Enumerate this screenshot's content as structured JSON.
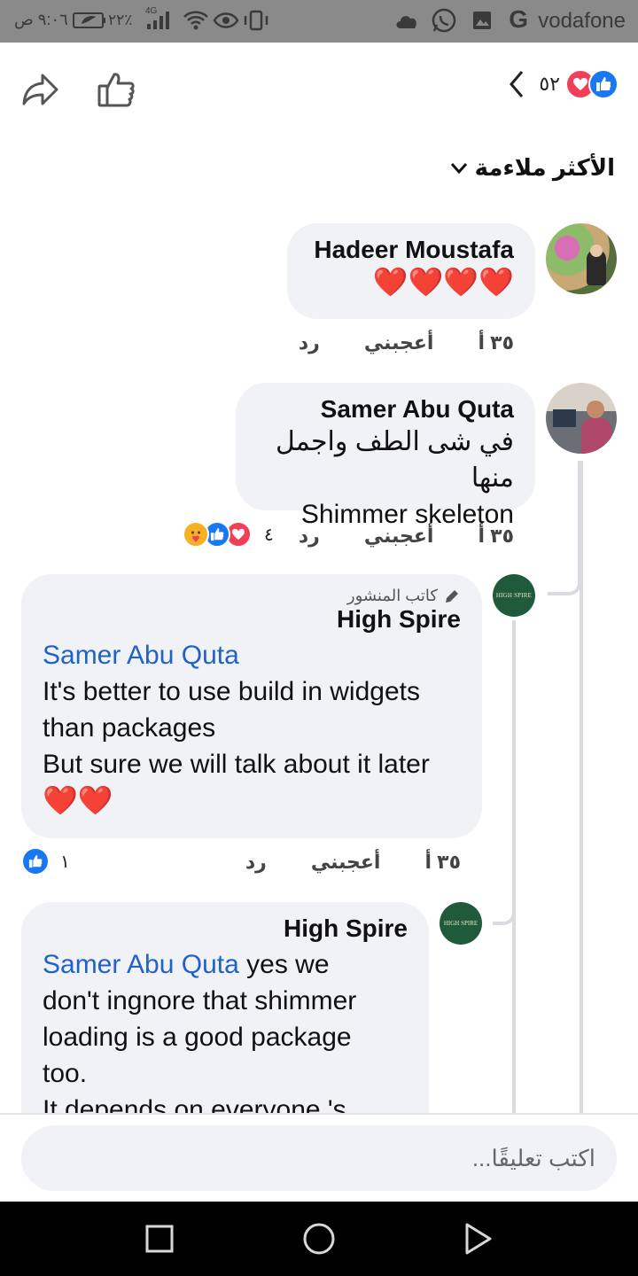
{
  "status_bar": {
    "time": "٩:٠٦ ص",
    "battery": "٢٢٪",
    "network": "4G",
    "carrier": "vodafone"
  },
  "header": {
    "reaction_count": "٥٢",
    "share_icon": "share-icon",
    "like_icon": "like-icon",
    "back_icon": "chevron-left-icon"
  },
  "sort": {
    "label": "الأكثر ملاءمة"
  },
  "comments": [
    {
      "author": "Hadeer Moustafa",
      "text": "❤️❤️❤️❤️",
      "time": "٣٥ أ",
      "like_label": "أعجبني",
      "reply_label": "رد"
    },
    {
      "author": "Samer Abu Quta",
      "line1": "في شى الطف واجمل منها",
      "line2": "Shimmer skeleton",
      "time": "٣٥ أ",
      "like_label": "أعجبني",
      "reply_label": "رد",
      "reaction_count": "٤"
    },
    {
      "author_tag": "كاتب المنشور",
      "author": "High Spire",
      "mention": "Samer Abu Quta",
      "line1": "It's better to use build in widgets",
      "line2": "than packages",
      "line3": "But sure we will talk about it later",
      "line4": "❤️❤️",
      "time": "٣٥ أ",
      "like_label": "أعجبني",
      "reply_label": "رد",
      "reaction_count": "١"
    },
    {
      "author": "High Spire",
      "mention": "Samer Abu Quta",
      "line1": " yes we",
      "line2": "don't ingnore that shimmer",
      "line3": "loading is a good package",
      "line4": "too.",
      "line5": "It depends on everyone 's"
    }
  ],
  "avatar_text": "HIGH SPIRE",
  "input": {
    "placeholder": "اكتب تعليقًا..."
  },
  "colors": {
    "accent": "#1877f2",
    "love": "#f33e58",
    "bubble": "#f0f2f5",
    "mention": "#2062c8"
  }
}
